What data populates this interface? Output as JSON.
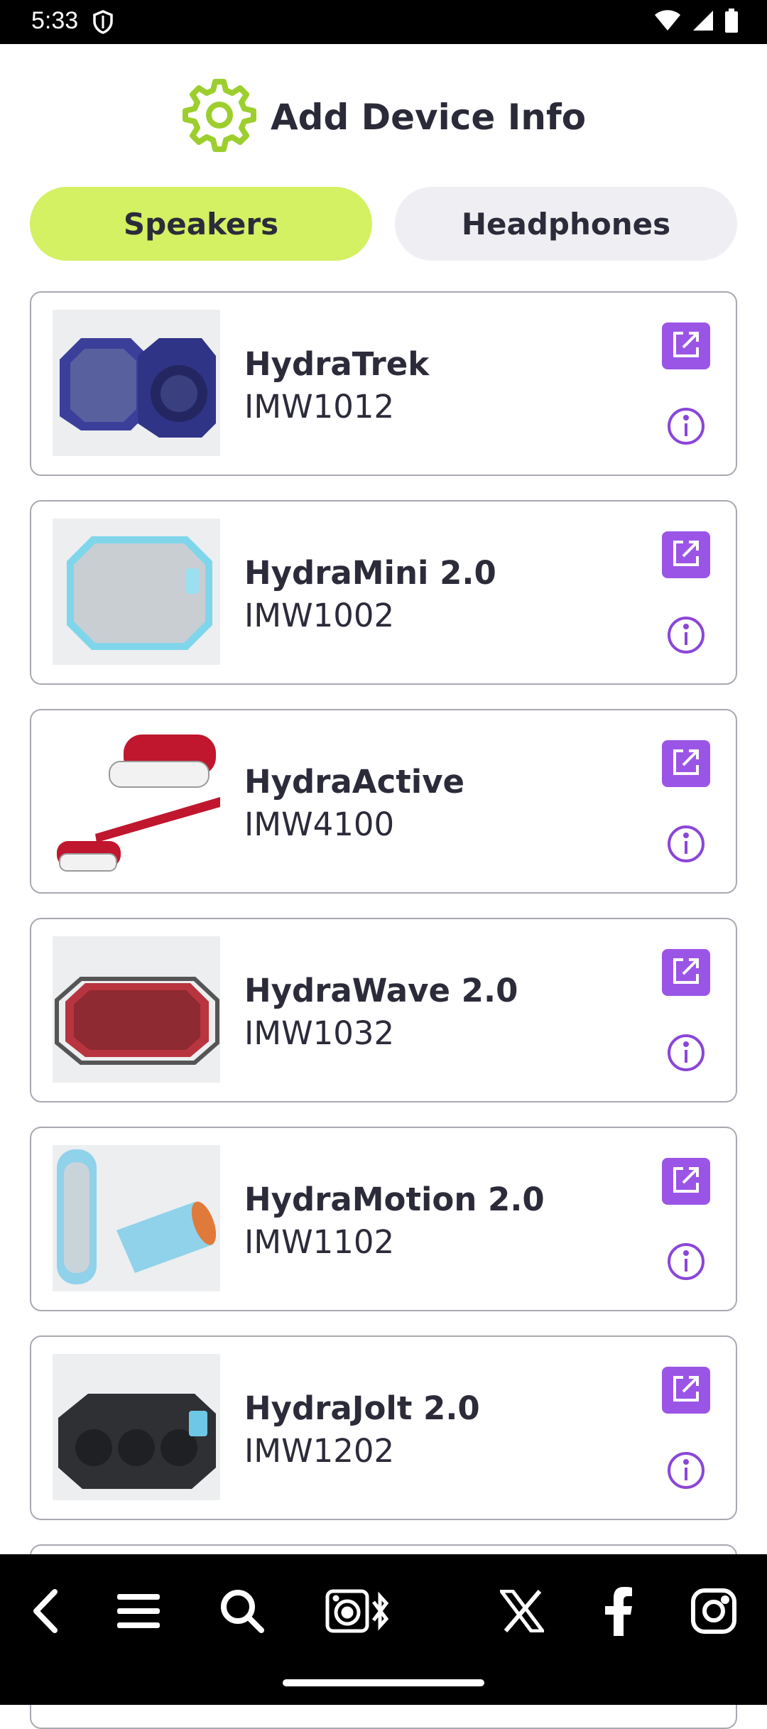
{
  "status_bar": {
    "time": "5:33",
    "icons": [
      "shield-icon",
      "wifi-icon",
      "signal-icon",
      "battery-icon"
    ]
  },
  "header": {
    "title": "Add Device Info",
    "icon": "gear-icon",
    "accent": "#9ccf2e"
  },
  "tabs": [
    {
      "label": "Speakers",
      "active": true
    },
    {
      "label": "Headphones",
      "active": false
    }
  ],
  "devices": [
    {
      "name": "HydraTrek",
      "model": "IMW1012",
      "color": "#3b3f9a"
    },
    {
      "name": "HydraMini 2.0",
      "model": "IMW1002",
      "color": "#7fd6ea"
    },
    {
      "name": "HydraActive",
      "model": "IMW4100",
      "color": "#c0162e"
    },
    {
      "name": "HydraWave 2.0",
      "model": "IMW1032",
      "color": "#b8343e"
    },
    {
      "name": "HydraMotion 2.0",
      "model": "IMW1102",
      "color": "#8fd2ea"
    },
    {
      "name": "HydraJolt 2.0",
      "model": "IMW1202",
      "color": "#2f3034"
    }
  ],
  "card_actions": {
    "open_icon": "external-link-icon",
    "info_icon": "info-icon",
    "button_color": "#9b55e6"
  },
  "bottom_nav": [
    "back-icon",
    "menu-icon",
    "search-icon",
    "speaker-bluetooth-icon",
    "x-icon",
    "facebook-icon",
    "instagram-icon"
  ]
}
